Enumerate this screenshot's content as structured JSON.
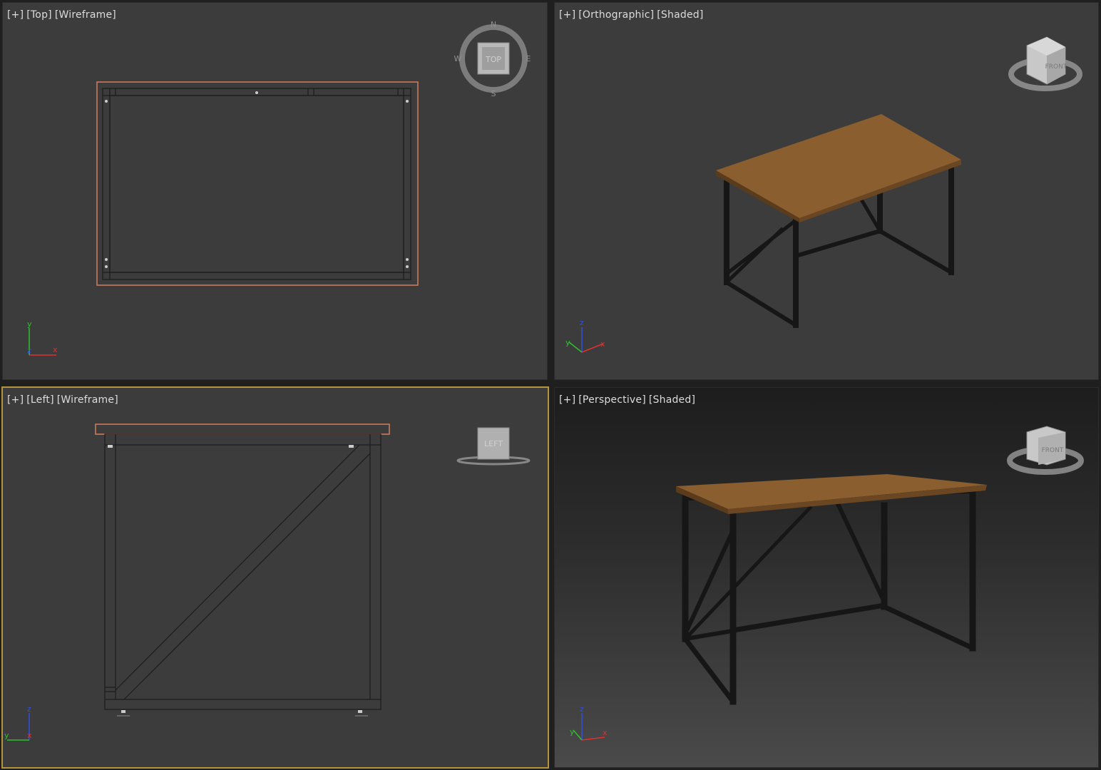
{
  "viewports": {
    "top": {
      "plus": "[+]",
      "view": "[Top]",
      "mode": "[Wireframe]",
      "cube_label": "TOP",
      "compass": {
        "n": "N",
        "s": "S",
        "e": "E",
        "w": "W"
      }
    },
    "ortho": {
      "plus": "[+]",
      "view": "[Orthographic]",
      "mode": "[Shaded]",
      "cube_label": "FRONT"
    },
    "left": {
      "plus": "[+]",
      "view": "[Left]",
      "mode": "[Wireframe]",
      "cube_label": "LEFT",
      "active": true
    },
    "persp": {
      "plus": "[+]",
      "view": "[Perspective]",
      "mode": "[Shaded]",
      "cube_label": "FRONT"
    }
  },
  "axes": {
    "top": {
      "a": "y",
      "b": "x",
      "c": "z"
    },
    "ortho": {
      "a": "z",
      "b": "x",
      "c": "y"
    },
    "left": {
      "a": "z",
      "b": "y",
      "c": "x"
    },
    "persp": {
      "a": "z",
      "b": "x",
      "c": "y"
    }
  },
  "colors": {
    "viewport_bg": "#3c3c3c",
    "active_border": "#b4953c",
    "selection": "#c87a5a",
    "wood": "#8a5e2e",
    "metal": "#1a1a1a",
    "axis_x": "#e03030",
    "axis_y": "#30c030",
    "axis_z": "#3050e0"
  }
}
